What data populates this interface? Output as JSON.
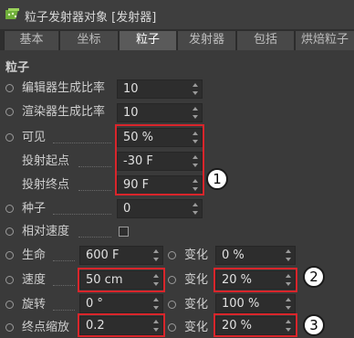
{
  "window": {
    "title": "粒子发射器对象 [发射器]"
  },
  "tabs": [
    {
      "label": "基本",
      "active": false
    },
    {
      "label": "坐标",
      "active": false
    },
    {
      "label": "粒子",
      "active": true
    },
    {
      "label": "发射器",
      "active": false
    },
    {
      "label": "包括",
      "active": false
    },
    {
      "label": "烘焙粒子",
      "active": false
    }
  ],
  "section": {
    "title": "粒子"
  },
  "fields": {
    "editor_rate": {
      "label": "编辑器生成比率",
      "value": "10"
    },
    "render_rate": {
      "label": "渲染器生成比率",
      "value": "10"
    },
    "visibility": {
      "label": "可见",
      "value": "50 %"
    },
    "emit_start": {
      "label": "投射起点",
      "value": "-30 F"
    },
    "emit_end": {
      "label": "投射终点",
      "value": "90 F"
    },
    "seed": {
      "label": "种子",
      "value": "0"
    },
    "relative_speed": {
      "label": "相对速度",
      "checked": false
    },
    "lifetime": {
      "label": "生命",
      "value": "600 F"
    },
    "lifetime_var": {
      "label": "变化",
      "value": "0 %"
    },
    "speed": {
      "label": "速度",
      "value": "50 cm"
    },
    "speed_var": {
      "label": "变化",
      "value": "20 %"
    },
    "rotation": {
      "label": "旋转",
      "value": "0 °"
    },
    "rotation_var": {
      "label": "变化",
      "value": "100 %"
    },
    "end_scale": {
      "label": "终点缩放",
      "value": "0.2"
    },
    "end_scale_var": {
      "label": "变化",
      "value": "20 %"
    }
  },
  "badges": [
    "1",
    "2",
    "3"
  ],
  "colors": {
    "highlight": "#d9252b",
    "panel_bg": "#3a3a3a",
    "field_bg": "#2d2d2d",
    "active_tab": "#5a5a5a"
  }
}
